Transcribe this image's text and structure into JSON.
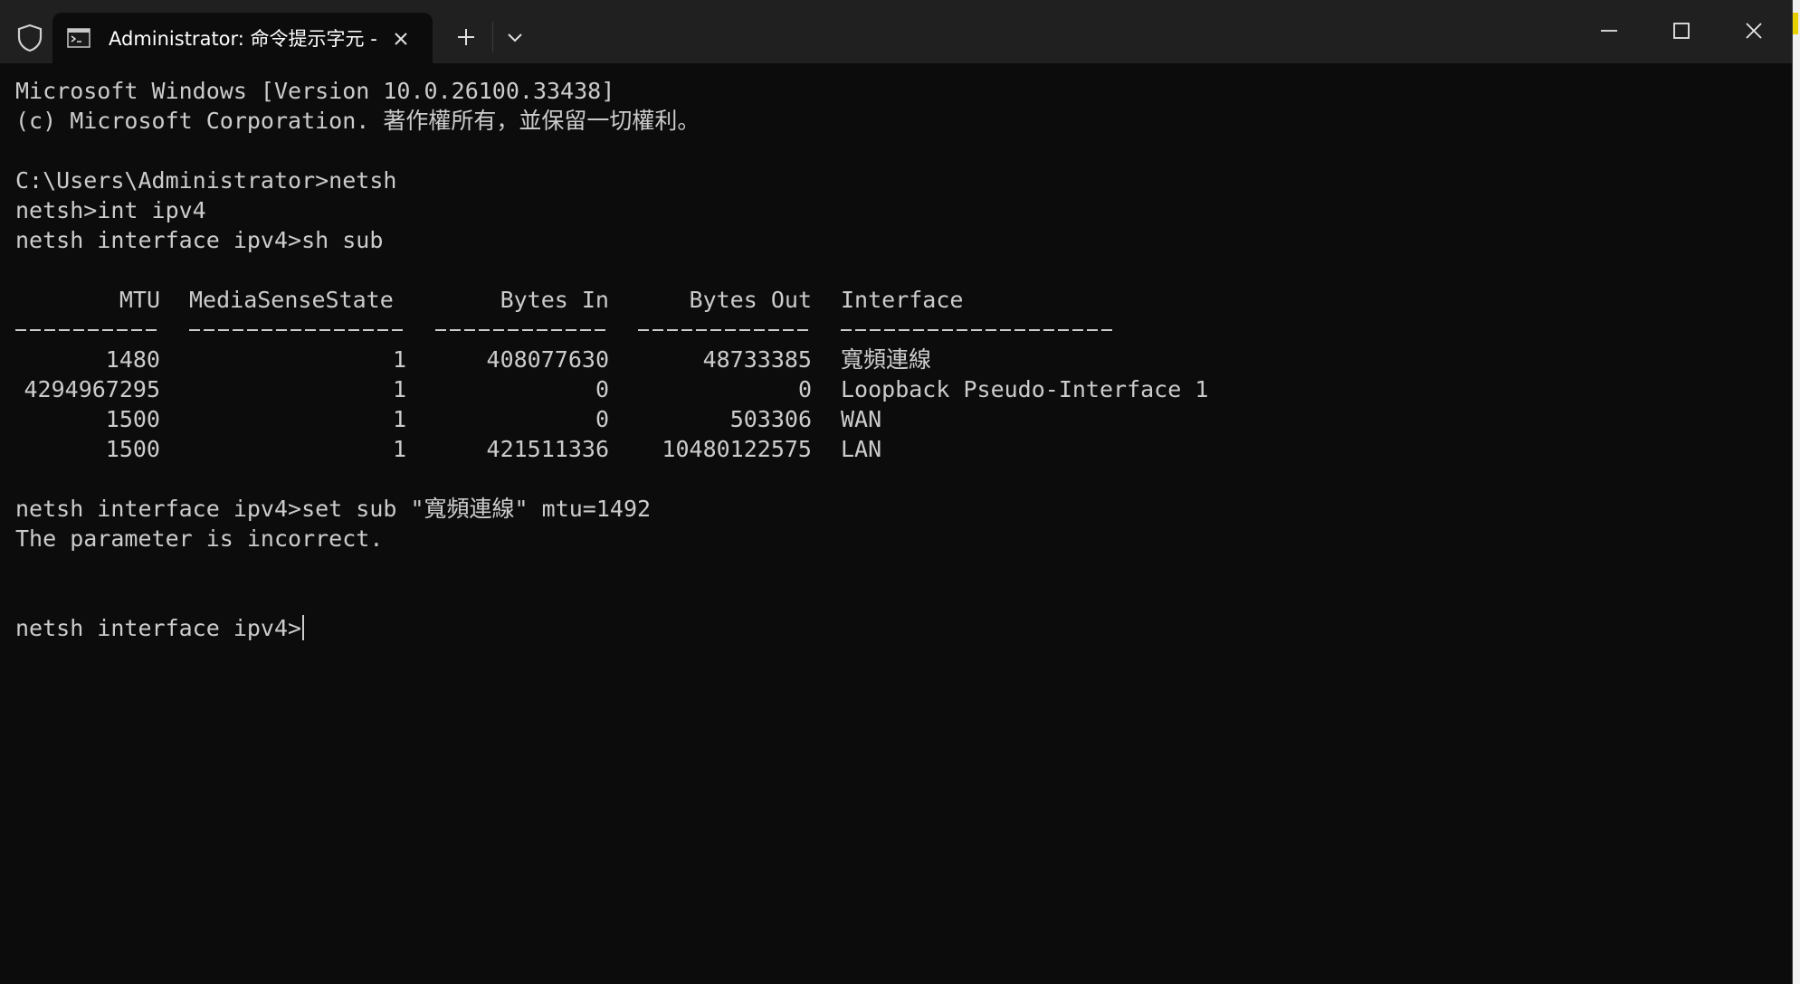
{
  "window": {
    "tab_title": "Administrator: 命令提示字元 -",
    "icons": {
      "shield": "shield-icon",
      "tab": "command-prompt-icon",
      "tab_close": "close-icon",
      "new_tab": "plus-icon",
      "dropdown": "chevron-down-icon",
      "minimize": "minimize-icon",
      "maximize": "maximize-icon",
      "close": "close-icon"
    },
    "colors": {
      "background": "#0c0c0c",
      "text": "#cccccc",
      "titlebar": "#202020"
    }
  },
  "terminal": {
    "banner_line1": "Microsoft Windows [Version 10.0.26100.33438]",
    "banner_line2": "(c) Microsoft Corporation. 著作權所有，並保留一切權利。",
    "cmd1": "C:\\Users\\Administrator>netsh",
    "cmd2": "netsh>int ipv4",
    "cmd3": "netsh interface ipv4>sh sub",
    "table": {
      "headers": {
        "mtu": "MTU",
        "media_sense_state": "MediaSenseState",
        "bytes_in": "Bytes In",
        "bytes_out": "Bytes Out",
        "interface": "Interface"
      },
      "rows": [
        {
          "mtu": "1480",
          "media_sense_state": "1",
          "bytes_in": "408077630",
          "bytes_out": "48733385",
          "interface": "寬頻連線"
        },
        {
          "mtu": "4294967295",
          "media_sense_state": "1",
          "bytes_in": "0",
          "bytes_out": "0",
          "interface": "Loopback Pseudo-Interface 1"
        },
        {
          "mtu": "1500",
          "media_sense_state": "1",
          "bytes_in": "0",
          "bytes_out": "503306",
          "interface": "WAN"
        },
        {
          "mtu": "1500",
          "media_sense_state": "1",
          "bytes_in": "421511336",
          "bytes_out": "10480122575",
          "interface": "LAN"
        }
      ]
    },
    "cmd4": "netsh interface ipv4>set sub \"寬頻連線\" mtu=1492",
    "error": "The parameter is incorrect.",
    "prompt": "netsh interface ipv4>"
  }
}
